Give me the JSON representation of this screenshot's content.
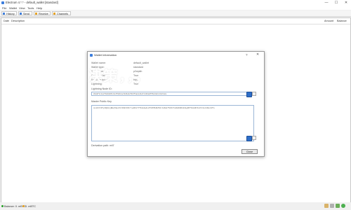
{
  "app": {
    "title": "Electrum 4.*.* - default_wallet [standard]"
  },
  "window_controls": {
    "minimize": "—",
    "maximize": "☐",
    "close": "✕"
  },
  "menu": [
    "File",
    "Wallet",
    "View",
    "Tools",
    "Help"
  ],
  "tabs": [
    {
      "label": "History",
      "icon": "history-icon",
      "color": "#3b7ddd"
    },
    {
      "label": "Send",
      "icon": "send-icon",
      "color": "#3b7ddd"
    },
    {
      "label": "Receive",
      "icon": "receive-icon",
      "color": "#e5a020"
    },
    {
      "label": "Channels",
      "icon": "channels-icon",
      "color": "#e5a020"
    }
  ],
  "table": {
    "columns": [
      "Date",
      "Description",
      "Amount",
      "Balance"
    ]
  },
  "status": {
    "balance": "Balance: 0. mBTC",
    "lightning": "0. mBTC",
    "balance_dot_color": "#2aa02a",
    "lightning_dot_color": "#e5a020"
  },
  "dialog": {
    "title": "Wallet Information",
    "help": "?",
    "close_x": "✕",
    "info_rows": [
      {
        "label": "Wallet name:",
        "value": "default_wallet"
      },
      {
        "label": "Wallet type:",
        "value": "standard"
      },
      {
        "label": "Script type:",
        "value": "p2wpkh"
      },
      {
        "label": "Seed available:",
        "value": "True"
      },
      {
        "label": "Keystore type:",
        "value": "bip32"
      },
      {
        "label": "Lightning:",
        "value": "True"
      }
    ],
    "overlay": "决策，，，",
    "lightning_node_label": "Lightning Node ID:",
    "lightning_node_value": "03a9f1c4e27b86d05c3e4f92b1a7d86e0c5b9f3a2e41d7c8b6a05f9e3d2c1b47a8e",
    "mpk_label": "Master Public Key",
    "mpk_value": "zpub6rFR7y4Q2AijBEqTUquhVz398htDFrtymD9xYYfG1m4wAcvPhXNfE3EfH1r1ADqtfSdVCToUG868RvUUkgDKf31mGDtKsAYz2oz2AGutZYs",
    "derivation_label": "Derivation path: m/0'",
    "close_label": "Close"
  }
}
